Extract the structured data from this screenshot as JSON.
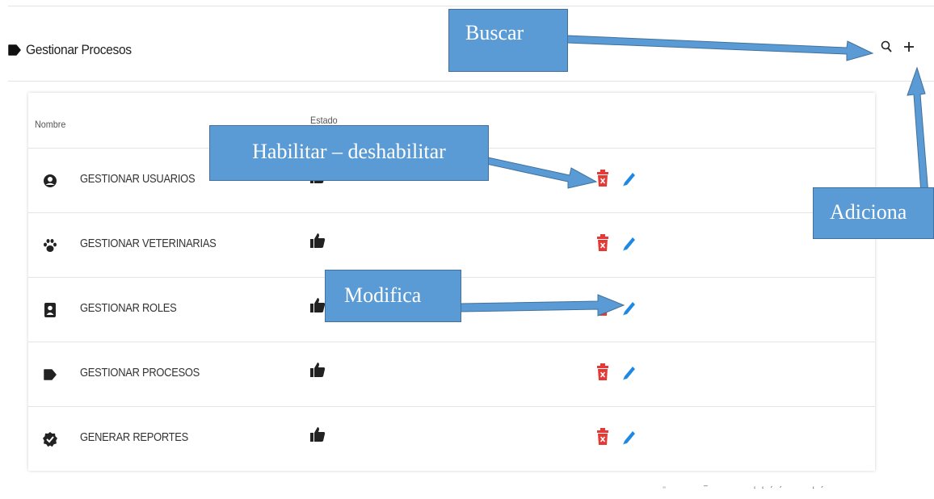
{
  "header": {
    "title": "Gestionar Procesos",
    "icon": "tag-icon"
  },
  "actions": {
    "search_icon": "search-icon",
    "add_icon": "plus-icon"
  },
  "table": {
    "columns": [
      "Nombre",
      "Estado"
    ],
    "rows": [
      {
        "name": "GESTIONAR USUARIOS",
        "icon": "user-circle-icon",
        "status_icon": "thumbs-up-icon"
      },
      {
        "name": "GESTIONAR VETERINARIAS",
        "icon": "paw-icon",
        "status_icon": "thumbs-up-icon"
      },
      {
        "name": "GESTIONAR ROLES",
        "icon": "id-badge-icon",
        "status_icon": "thumbs-up-icon"
      },
      {
        "name": "GESTIONAR PROCESOS",
        "icon": "tag-icon",
        "status_icon": "thumbs-up-icon"
      },
      {
        "name": "GENERAR REPORTES",
        "icon": "verified-badge-icon",
        "status_icon": "thumbs-up-icon"
      }
    ],
    "row_actions": {
      "disable_icon": "trash-icon",
      "edit_icon": "pencil-icon"
    }
  },
  "annotations": {
    "buscar": "Buscar",
    "habilitar": "Habilitar – deshabilitar",
    "modifica": "Modifica",
    "adiciona": "Adiciona"
  },
  "colors": {
    "callout": "#5b9bd5",
    "trash": "#e53935",
    "edit": "#1e88e5"
  }
}
